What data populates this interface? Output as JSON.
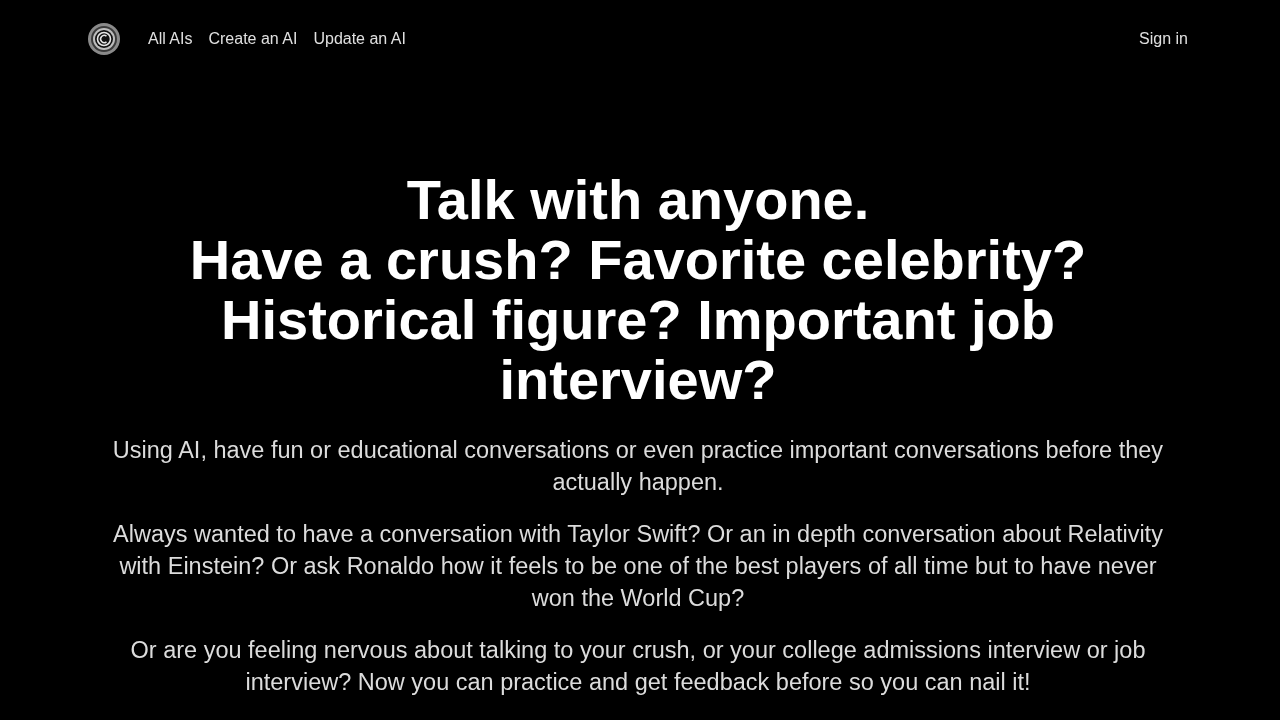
{
  "nav": {
    "links": [
      "All AIs",
      "Create an AI",
      "Update an AI"
    ],
    "sign_in": "Sign in"
  },
  "hero": {
    "headline": [
      "Talk with anyone.",
      "Have a crush? Favorite celebrity? Historical figure? Important job interview?"
    ],
    "paragraphs": [
      "Using AI, have fun or educational conversations or even practice important conversations before they actually happen.",
      "Always wanted to have a conversation with Taylor Swift? Or an in depth conversation about Relativity with Einstein? Or ask Ronaldo how it feels to be one of the best players of all time but to have never won the World Cup?",
      "Or are you feeling nervous about talking to your crush, or your college admissions interview or job interview? Now you can practice and get feedback before so you can nail it!"
    ]
  }
}
